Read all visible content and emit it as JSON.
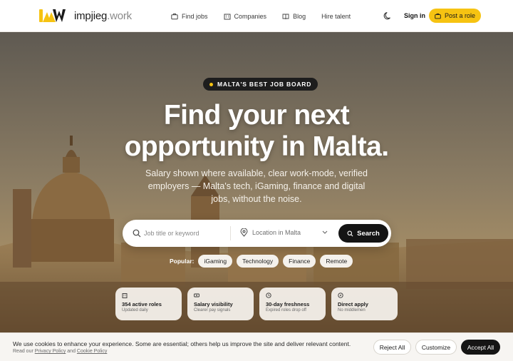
{
  "brand": {
    "name_main": "impjieg",
    "name_tld": ".work",
    "accent": "#f6c312"
  },
  "nav": {
    "links": [
      {
        "label": "Find jobs",
        "icon": "briefcase-icon"
      },
      {
        "label": "Companies",
        "icon": "building-icon"
      },
      {
        "label": "Blog",
        "icon": "book-icon"
      },
      {
        "label": "Hire talent",
        "icon": ""
      }
    ],
    "theme_icon": "moon-icon",
    "signin_label": "Sign in",
    "post_label": "Post a role",
    "post_icon": "briefcase-icon"
  },
  "hero": {
    "badge": "MALTA'S BEST JOB BOARD",
    "headline_line1": "Find your next",
    "headline_line2": "opportunity in Malta.",
    "subline": "Salary shown where available, clear work-mode, verified employers — Malta's tech, iGaming, finance and digital jobs, without the noise."
  },
  "search": {
    "keyword_placeholder": "Job title or keyword",
    "location_value": "Location in Malta",
    "button_label": "Search"
  },
  "popular": {
    "label": "Popular:",
    "chips": [
      "iGaming",
      "Technology",
      "Finance",
      "Remote"
    ]
  },
  "features": [
    {
      "icon": "building-icon",
      "title": "354 active roles",
      "subtitle": "Updated daily"
    },
    {
      "icon": "cash-icon",
      "title": "Salary visibility",
      "subtitle": "Clearer pay signals"
    },
    {
      "icon": "clock-icon",
      "title": "30-day freshness",
      "subtitle": "Expired roles drop off"
    },
    {
      "icon": "compass-icon",
      "title": "Direct apply",
      "subtitle": "No middlemen"
    }
  ],
  "cookie": {
    "message": "We use cookies to enhance your experience. Some are essential; others help us improve the site and deliver relevant content.",
    "read_prefix": "Read our",
    "privacy_link": "Privacy Policy",
    "and": "and",
    "cookie_link": "Cookie Policy",
    "reject_label": "Reject All",
    "customize_label": "Customize",
    "accept_label": "Accept All"
  }
}
